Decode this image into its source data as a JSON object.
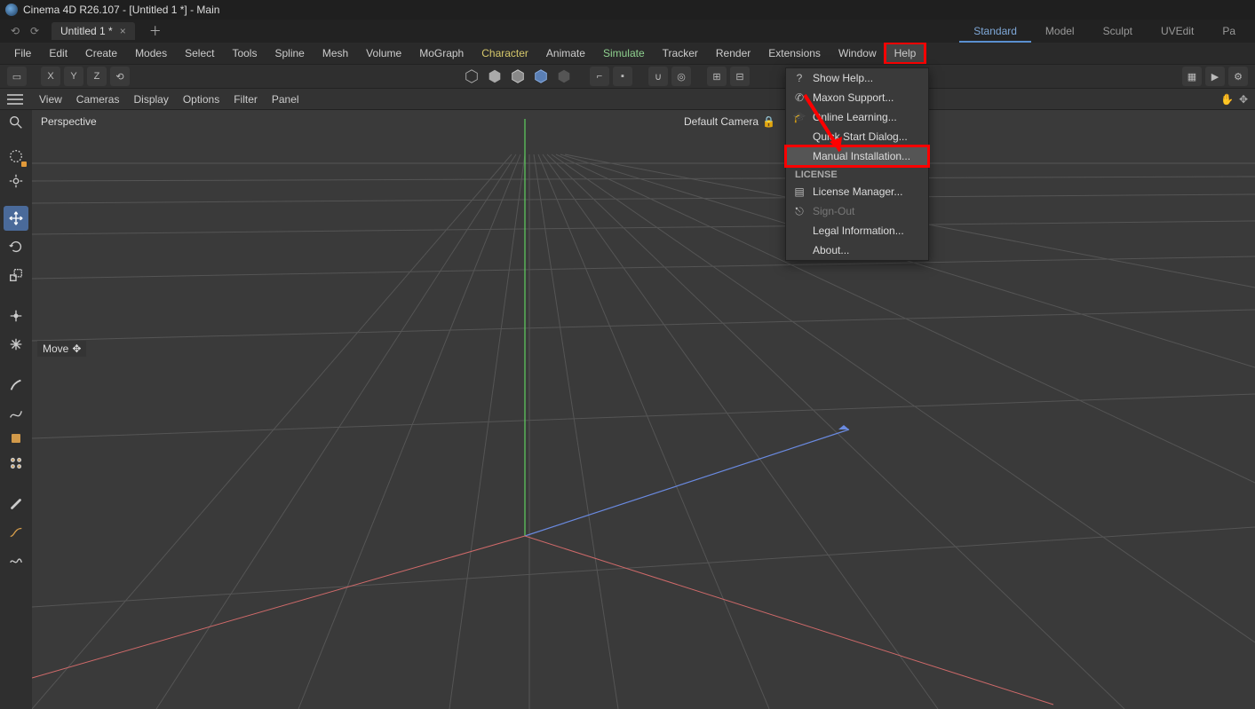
{
  "title": "Cinema 4D R26.107 - [Untitled 1 *] - Main",
  "doc_tab": {
    "label": "Untitled 1 *",
    "close": "×"
  },
  "add_tab": "＋",
  "layout_tabs": [
    "Standard",
    "Model",
    "Sculpt",
    "UVEdit",
    "Pa"
  ],
  "layout_active": 0,
  "menu": [
    "File",
    "Edit",
    "Create",
    "Modes",
    "Select",
    "Tools",
    "Spline",
    "Mesh",
    "Volume",
    "MoGraph",
    "Character",
    "Animate",
    "Simulate",
    "Tracker",
    "Render",
    "Extensions",
    "Window",
    "Help"
  ],
  "axis_buttons": [
    "X",
    "Y",
    "Z"
  ],
  "viewmenu": [
    "View",
    "Cameras",
    "Display",
    "Options",
    "Filter",
    "Panel"
  ],
  "viewport": {
    "left_label": "Perspective",
    "right_label": "Default Camera",
    "tool_hint": "Move"
  },
  "help_menu": {
    "items": [
      {
        "icon": "?",
        "label": "Show Help..."
      },
      {
        "icon": "phone",
        "label": "Maxon Support..."
      },
      {
        "icon": "grad",
        "label": "Online Learning..."
      },
      {
        "icon": "",
        "label": "Quick Start Dialog..."
      },
      {
        "icon": "",
        "label": "Manual Installation...",
        "hl": true
      }
    ],
    "section": "LICENSE",
    "items2": [
      {
        "icon": "doc",
        "label": "License Manager..."
      },
      {
        "icon": "out",
        "label": "Sign-Out",
        "disabled": true
      },
      {
        "icon": "",
        "label": "Legal Information..."
      },
      {
        "icon": "",
        "label": "About..."
      }
    ]
  }
}
